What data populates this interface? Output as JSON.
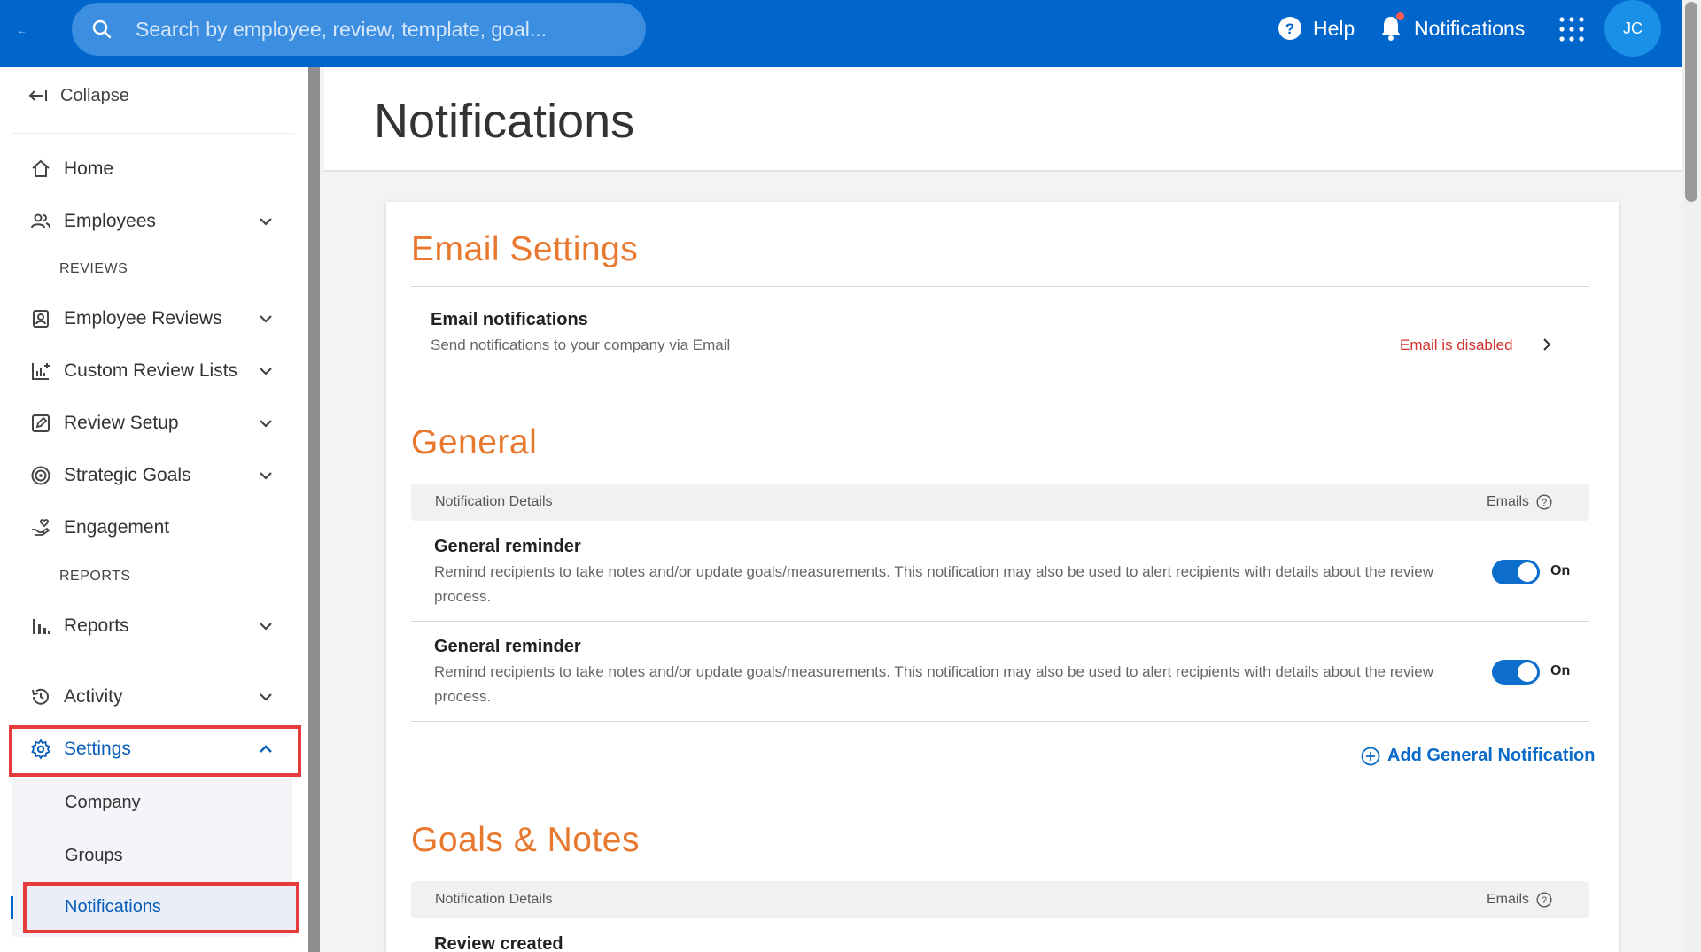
{
  "topbar": {
    "search_placeholder": "Search by employee, review, template, goal...",
    "help_label": "Help",
    "notifications_label": "Notifications",
    "avatar_initials": "JC"
  },
  "sidebar": {
    "collapse_label": "Collapse",
    "items": {
      "home": "Home",
      "employees": "Employees",
      "reviews_section": "REVIEWS",
      "employee_reviews": "Employee Reviews",
      "custom_review_lists": "Custom Review Lists",
      "review_setup": "Review Setup",
      "strategic_goals": "Strategic Goals",
      "engagement": "Engagement",
      "reports_section": "REPORTS",
      "reports": "Reports",
      "activity": "Activity",
      "settings": "Settings"
    },
    "settings_sub": {
      "company": "Company",
      "groups": "Groups",
      "notifications": "Notifications"
    }
  },
  "main": {
    "page_title": "Notifications",
    "email_settings": {
      "title": "Email Settings",
      "row_title": "Email notifications",
      "row_desc": "Send notifications to your company via Email",
      "status": "Email is disabled"
    },
    "general": {
      "title": "General",
      "header_details": "Notification Details",
      "header_emails": "Emails",
      "rows": [
        {
          "title": "General reminder",
          "desc": "Remind recipients to take notes and/or update goals/measurements. This notification may also be used to alert recipients with details about the review process.",
          "toggle": "On"
        },
        {
          "title": "General reminder",
          "desc": "Remind recipients to take notes and/or update goals/measurements. This notification may also be used to alert recipients with details about the review process.",
          "toggle": "On"
        }
      ],
      "add_label": "Add General Notification"
    },
    "goals_notes": {
      "title": "Goals & Notes",
      "header_details": "Notification Details",
      "header_emails": "Emails",
      "first_row_title": "Review created"
    }
  },
  "colors": {
    "topbar": "#0066cc",
    "accent_orange": "#e8782d",
    "link_blue": "#0a6ac9",
    "error_red": "#d0322e",
    "highlight_red": "#e53b3b"
  }
}
